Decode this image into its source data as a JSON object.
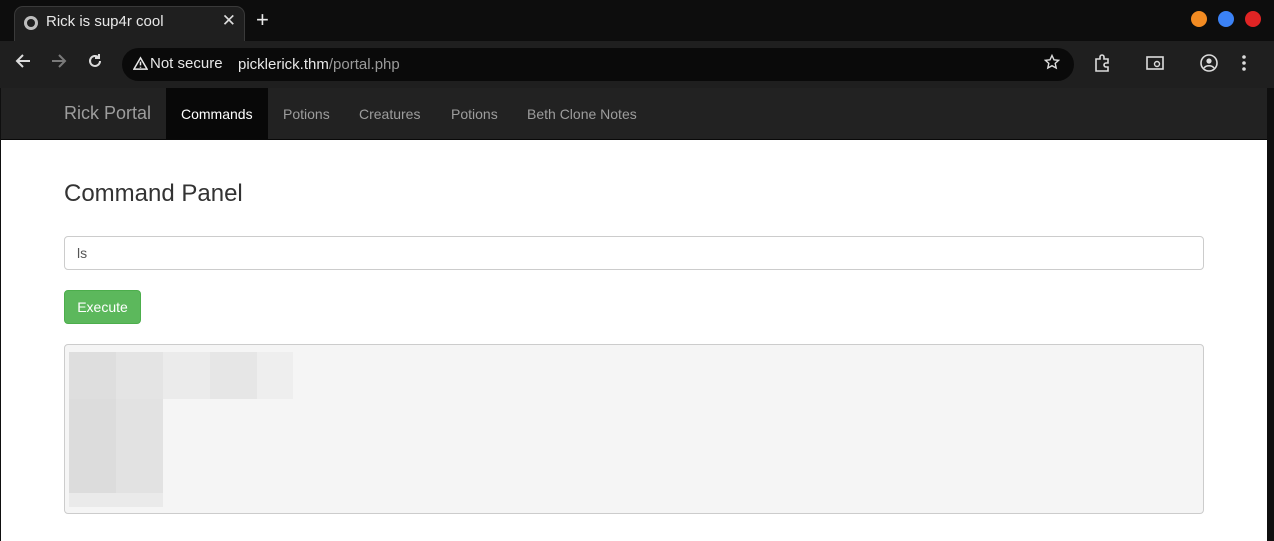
{
  "browser": {
    "tab_title": "Rick is sup4r cool",
    "tab_close": "✕",
    "new_tab": "+",
    "not_secure": "Not secure",
    "url_host": "picklerick.thm",
    "url_path": "/portal.php",
    "window_colors": [
      "#f28b22",
      "#3b82f6",
      "#e02424"
    ]
  },
  "navbar": {
    "brand": "Rick Portal",
    "items": [
      {
        "label": "Commands",
        "active": true
      },
      {
        "label": "Potions",
        "active": false
      },
      {
        "label": "Creatures",
        "active": false
      },
      {
        "label": "Potions",
        "active": false
      },
      {
        "label": "Beth Clone Notes",
        "active": false
      }
    ]
  },
  "main": {
    "heading": "Command Panel",
    "command_value": "ls",
    "execute_label": "Execute"
  },
  "colors": {
    "accent_green": "#5cb85c",
    "navbar_bg": "#222222"
  }
}
